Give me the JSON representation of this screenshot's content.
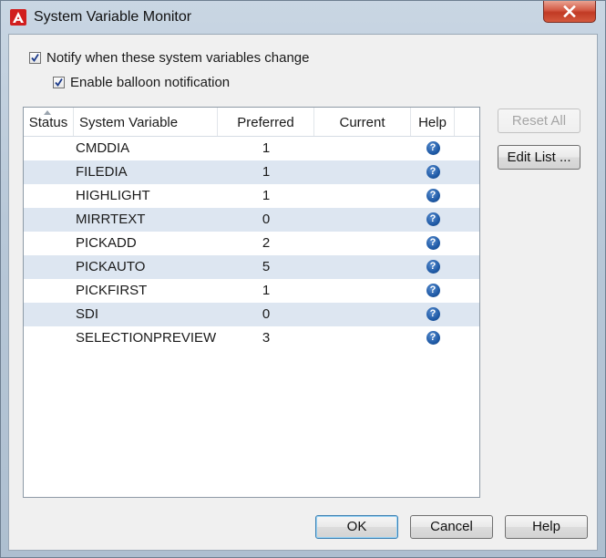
{
  "window": {
    "title": "System Variable Monitor",
    "close_glyph": "×"
  },
  "options": {
    "notify_label": "Notify when these system variables change",
    "notify_checked": true,
    "balloon_label": "Enable balloon notification",
    "balloon_checked": true
  },
  "table": {
    "columns": {
      "status": "Status",
      "variable": "System Variable",
      "preferred": "Preferred",
      "current": "Current",
      "help": "Help"
    },
    "rows": [
      {
        "name": "CMDDIA",
        "preferred": "1",
        "current": ""
      },
      {
        "name": "FILEDIA",
        "preferred": "1",
        "current": ""
      },
      {
        "name": "HIGHLIGHT",
        "preferred": "1",
        "current": ""
      },
      {
        "name": "MIRRTEXT",
        "preferred": "0",
        "current": ""
      },
      {
        "name": "PICKADD",
        "preferred": "2",
        "current": ""
      },
      {
        "name": "PICKAUTO",
        "preferred": "5",
        "current": ""
      },
      {
        "name": "PICKFIRST",
        "preferred": "1",
        "current": ""
      },
      {
        "name": "SDI",
        "preferred": "0",
        "current": ""
      },
      {
        "name": "SELECTIONPREVIEW",
        "preferred": "3",
        "current": ""
      }
    ],
    "help_glyph": "?"
  },
  "side_buttons": {
    "reset_all": "Reset All",
    "edit_list": "Edit List ..."
  },
  "footer": {
    "ok": "OK",
    "cancel": "Cancel",
    "help": "Help"
  },
  "colors": {
    "accent_blue": "#1f5aa6",
    "alt_row": "#dde6f1",
    "close_red": "#c13a24"
  },
  "icons": {
    "app": "autocad-logo-icon",
    "help": "question-circle-icon",
    "close": "close-icon",
    "check": "checkmark-icon"
  }
}
